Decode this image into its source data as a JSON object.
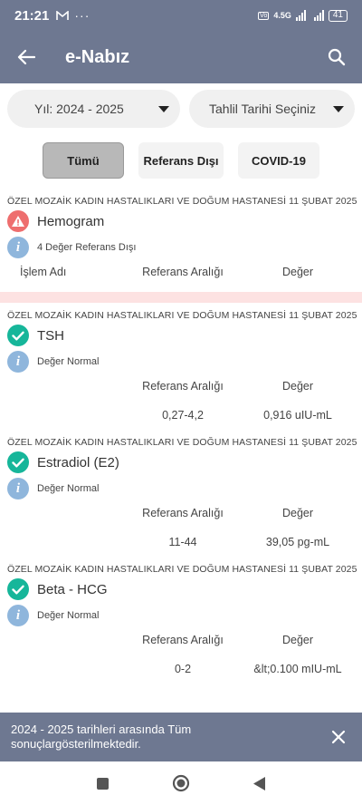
{
  "status_bar": {
    "time": "21:21",
    "network": "4.5G",
    "battery": "41"
  },
  "app_bar": {
    "title": "e-Nabız"
  },
  "filters": {
    "year": "Yıl: 2024 - 2025",
    "date": "Tahlil Tarihi Seçiniz"
  },
  "segments": [
    "Tümü",
    "Referans Dışı",
    "COVID-19"
  ],
  "results": [
    {
      "hospital": "ÖZEL MOZAİK KADIN HASTALIKLARI VE DOĞUM HASTANESİ 11 ŞUBAT 2025",
      "test": "Hemogram",
      "status": "warning",
      "info": "4 Değer Referans Dışı",
      "col_name": "İşlem Adı",
      "col_ref": "Referans Aralığı",
      "col_val": "Değer"
    },
    {
      "hospital": "ÖZEL MOZAİK KADIN HASTALIKLARI VE DOĞUM HASTANESİ 11 ŞUBAT 2025",
      "test": "TSH",
      "status": "ok",
      "info": "Değer Normal",
      "col_ref": "Referans Aralığı",
      "col_val": "Değer",
      "ref": "0,27-4,2",
      "value": "0,916 uIU-mL"
    },
    {
      "hospital": "ÖZEL MOZAİK KADIN HASTALIKLARI VE DOĞUM HASTANESİ 11 ŞUBAT 2025",
      "test": "Estradiol (E2)",
      "status": "ok",
      "info": "Değer Normal",
      "col_ref": "Referans Aralığı",
      "col_val": "Değer",
      "ref": "11-44",
      "value": "39,05 pg-mL"
    },
    {
      "hospital": "ÖZEL MOZAİK KADIN HASTALIKLARI VE DOĞUM HASTANESİ 11 ŞUBAT 2025",
      "test": "Beta - HCG",
      "status": "ok",
      "info": "Değer Normal",
      "col_ref": "Referans Aralığı",
      "col_val": "Değer",
      "ref": "0-2",
      "value": "&lt;0.100 mIU-mL"
    }
  ],
  "snackbar": {
    "message": "2024 - 2025 tarihleri arasında Tüm sonuçlargösterilmektedir."
  },
  "colors": {
    "header": "#6e7891",
    "ok": "#16b69a",
    "warning": "#ee6e6e",
    "info": "#8fb6dc",
    "divider": "#fde2e2"
  }
}
